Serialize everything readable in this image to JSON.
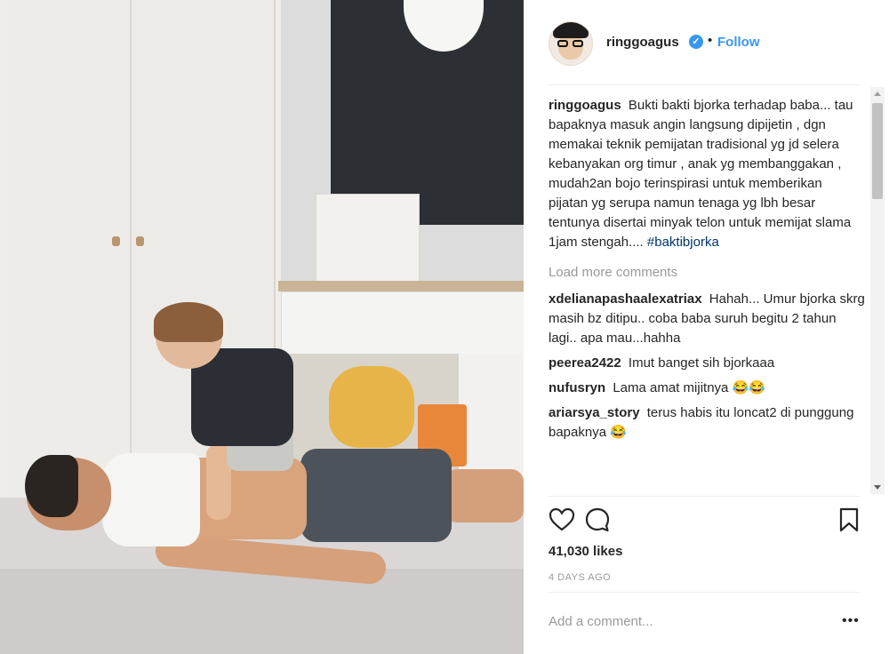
{
  "post": {
    "username": "ringgoagus",
    "follow_label": "Follow",
    "separator_dot": "•"
  },
  "comments": {
    "caption": {
      "user": "ringgoagus",
      "text": "Bukti bakti bjorka terhadap baba... tau bapaknya masuk angin langsung dipijetin , dgn memakai teknik pemijatan tradisional yg jd selera kebanyakan org timur , anak yg membanggakan , mudah2an bojo terinspirasi untuk memberikan pijatan yg serupa namun tenaga yg lbh besar tentunya disertai minyak telon untuk memijat slama 1jam stengah....",
      "hashtag": "#baktibjorka"
    },
    "load_more": "Load more comments",
    "items": [
      {
        "user": "xdelianapashaalexatriax",
        "text": "Hahah... Umur bjorka skrg masih bz ditipu.. coba baba suruh begitu 2 tahun lagi.. apa mau...hahha"
      },
      {
        "user": "peerea2422",
        "text": "Imut banget sih bjorkaaa"
      },
      {
        "user": "nufusryn",
        "text": "Lama amat mijitnya 😂😂"
      },
      {
        "user": "ariarsya_story",
        "text": "terus habis itu loncat2 di punggung bapaknya 😂"
      }
    ]
  },
  "stats": {
    "likes": "41,030 likes",
    "time": "4 DAYS AGO"
  },
  "composer": {
    "placeholder": "Add a comment...",
    "more": "•••"
  },
  "icons": {
    "like": "heart-icon",
    "comment": "comment-bubble-icon",
    "save": "bookmark-icon",
    "verified": "verified-badge-icon"
  },
  "colors": {
    "link_blue": "#3897f0",
    "hashtag": "#003569",
    "muted": "#999999"
  }
}
